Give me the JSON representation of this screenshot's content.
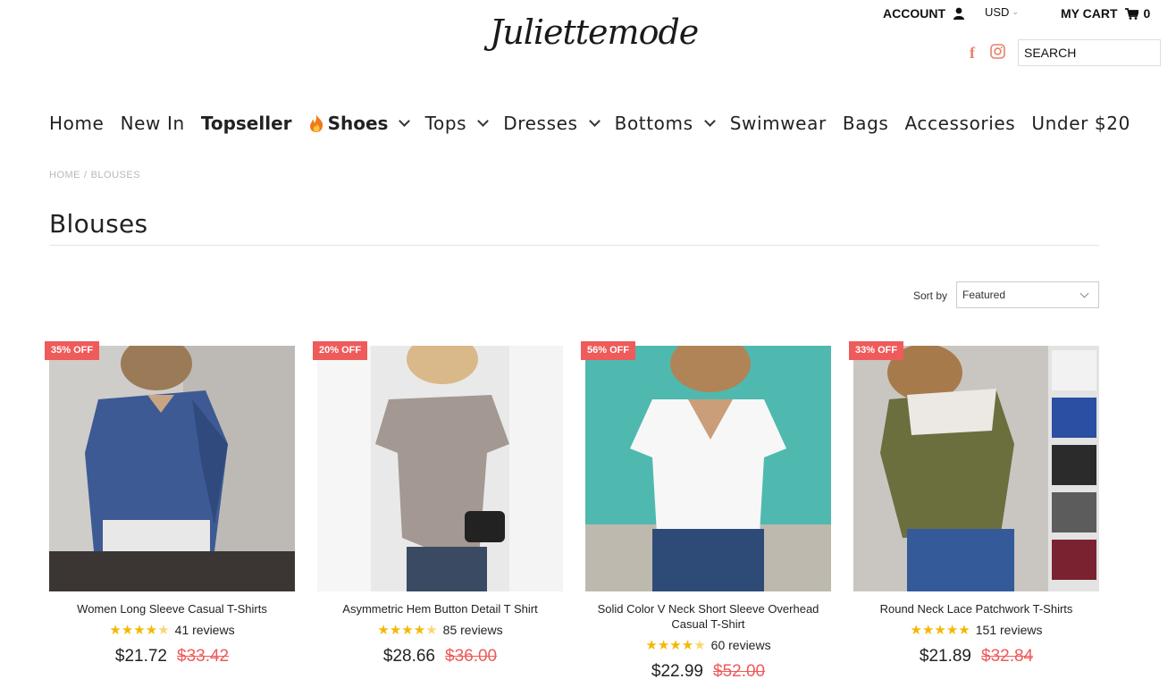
{
  "header": {
    "logo": "Juliettemode",
    "account_label": "ACCOUNT",
    "currency": "USD",
    "cart_label": "MY CART",
    "cart_count": "0",
    "search_placeholder": "SEARCH",
    "icons": [
      "user-icon",
      "chevron-down-icon",
      "cart-icon",
      "facebook-icon",
      "instagram-icon"
    ]
  },
  "nav": {
    "items": [
      {
        "label": "Home"
      },
      {
        "label": "New In"
      },
      {
        "label": "Topseller"
      },
      {
        "label": "Shoes"
      },
      {
        "label": "Tops"
      },
      {
        "label": "Dresses"
      },
      {
        "label": "Bottoms"
      },
      {
        "label": "Swimwear"
      },
      {
        "label": "Bags"
      },
      {
        "label": "Accessories"
      },
      {
        "label": "Under $20"
      }
    ]
  },
  "breadcrumb": {
    "home": "HOME",
    "separator": "/",
    "current": "BLOUSES"
  },
  "page_title": "Blouses",
  "sort": {
    "label": "Sort by",
    "value": "Featured"
  },
  "colors": {
    "accent": "#ef5a5a",
    "star": "#f5b800",
    "facebook": "#e8806a"
  },
  "products": [
    {
      "badge": "35% OFF",
      "name": "Women Long Sleeve Casual T-Shirts",
      "rating": 4.5,
      "reviews": "41 reviews",
      "price": "$21.72",
      "compare_price": "$33.42"
    },
    {
      "badge": "20% OFF",
      "name": "Asymmetric Hem Button Detail T Shirt",
      "rating": 4.5,
      "reviews": "85 reviews",
      "price": "$28.66",
      "compare_price": "$36.00"
    },
    {
      "badge": "56% OFF",
      "name": "Solid Color V Neck Short Sleeve Overhead Casual T-Shirt",
      "rating": 4.5,
      "reviews": "60 reviews",
      "price": "$22.99",
      "compare_price": "$52.00"
    },
    {
      "badge": "33% OFF",
      "name": "Round Neck Lace Patchwork T-Shirts",
      "rating": 5,
      "reviews": "151 reviews",
      "price": "$21.89",
      "compare_price": "$32.84"
    }
  ]
}
